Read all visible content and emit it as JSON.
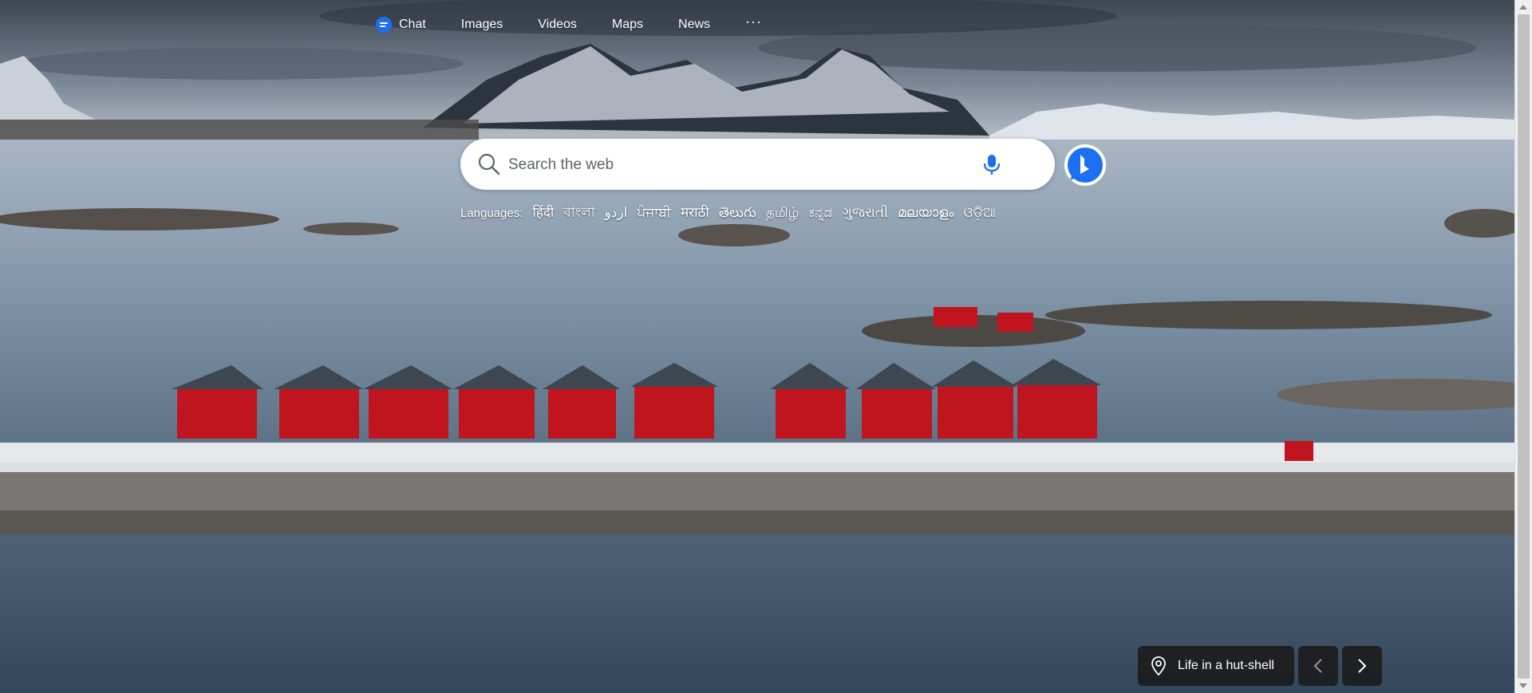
{
  "nav": {
    "items": [
      {
        "label": "Chat"
      },
      {
        "label": "Images"
      },
      {
        "label": "Videos"
      },
      {
        "label": "Maps"
      },
      {
        "label": "News"
      }
    ],
    "more_label": "···"
  },
  "search": {
    "placeholder": "Search the web",
    "value": ""
  },
  "languages": {
    "label": "Languages:",
    "items": [
      "हिंदी",
      "বাংলা",
      "اردو",
      "ਪੰਜਾਬੀ",
      "मराठी",
      "తెలుగు",
      "தமிழ்",
      "ಕನ್ನಡ",
      "ગુજરાતી",
      "മലയാളം",
      "ଓଡ଼ିଆ"
    ]
  },
  "image_caption": {
    "title": "Life in a hut-shell",
    "icon": "location-pin-icon"
  },
  "colors": {
    "accent": "#1b6ff0",
    "hut_red": "#c0141e",
    "caption_bg": "#1a1a1a"
  }
}
